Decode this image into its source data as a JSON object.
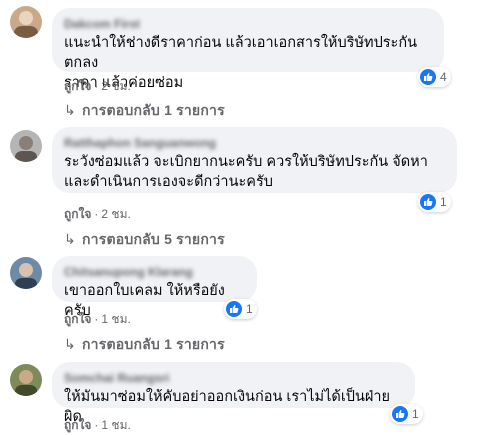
{
  "comments": [
    {
      "author": "Dakcom First",
      "text": "แนะนำให้ช่างดีราคาก่อน แล้วเอาเอกสารให้บริษัทประกันตกลง\nราคา แล้วค่อยซ่อม",
      "like_label": "ถูกใจ",
      "time": "2 ชม.",
      "reaction_count": "4",
      "reply_label": "การตอบกลับ 1 รายการ"
    },
    {
      "author": "Ratthaphon Sanguanwong",
      "text": "ระวังซ่อมแล้ว จะเบิกยากนะครับ ควรให้บริษัทประกัน จัดหา\nและดำเนินการเองจะดีกว่านะครับ",
      "like_label": "ถูกใจ",
      "time": "2 ชม.",
      "reaction_count": "1",
      "reply_label": "การตอบกลับ 5 รายการ"
    },
    {
      "author": "Chitsanupong Klarang",
      "text": "เขาออกใบเคลม ให้หรือยังครับ",
      "like_label": "ถูกใจ",
      "time": "1 ชม.",
      "reaction_count": "1",
      "reply_label": "การตอบกลับ 1 รายการ"
    },
    {
      "author": "Somchai Ruangsri",
      "text": "ให้มันมาซ่อมให้คับอย่าออกเงินก่อน เราไม่ได้เป็นฝ่ายผิด",
      "like_label": "ถูกใจ",
      "time": "1 ชม.",
      "reaction_count": "1"
    }
  ],
  "colors": {
    "bubble": "#f0f2f5",
    "secondary_text": "#65676b",
    "like_blue": "#1877f2"
  }
}
